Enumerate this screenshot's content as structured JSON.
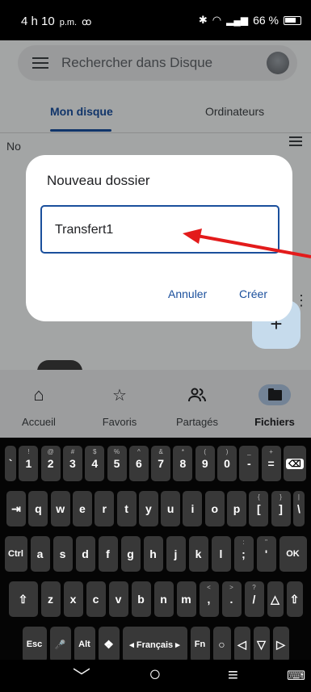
{
  "status": {
    "time": "4 h 10",
    "ampm": "p.m.",
    "voicemail": "ꝏ",
    "battery_pct": "66 %"
  },
  "search": {
    "placeholder": "Rechercher dans Disque"
  },
  "tabs": [
    {
      "label": "Mon disque"
    },
    {
      "label": "Ordinateurs"
    }
  ],
  "behind": {
    "partial_label": "No"
  },
  "dialog": {
    "title": "Nouveau dossier",
    "input_value": "Transfert1",
    "cancel": "Annuler",
    "create": "Créer"
  },
  "fab": {
    "label": "+"
  },
  "bottom_nav": [
    {
      "label": "Accueil",
      "icon": "home-icon",
      "glyph": "⌂"
    },
    {
      "label": "Favoris",
      "icon": "star-icon",
      "glyph": "☆"
    },
    {
      "label": "Partagés",
      "icon": "people-icon",
      "glyph": "👥"
    },
    {
      "label": "Fichiers",
      "icon": "folder-icon",
      "glyph": ""
    }
  ],
  "keyboard": {
    "row1": [
      {
        "k": "`",
        "s": ""
      },
      {
        "k": "1",
        "s": "!"
      },
      {
        "k": "2",
        "s": "@"
      },
      {
        "k": "3",
        "s": "#"
      },
      {
        "k": "4",
        "s": "$"
      },
      {
        "k": "5",
        "s": "%"
      },
      {
        "k": "6",
        "s": "^"
      },
      {
        "k": "7",
        "s": "&"
      },
      {
        "k": "8",
        "s": "*"
      },
      {
        "k": "9",
        "s": "("
      },
      {
        "k": "0",
        "s": ")"
      },
      {
        "k": "-",
        "s": "_"
      },
      {
        "k": "=",
        "s": "+"
      },
      {
        "k": "⌫",
        "s": ""
      }
    ],
    "row2": [
      {
        "k": "⇥",
        "s": ""
      },
      {
        "k": "q",
        "s": ""
      },
      {
        "k": "w",
        "s": ""
      },
      {
        "k": "e",
        "s": ""
      },
      {
        "k": "r",
        "s": ""
      },
      {
        "k": "t",
        "s": ""
      },
      {
        "k": "y",
        "s": ""
      },
      {
        "k": "u",
        "s": ""
      },
      {
        "k": "i",
        "s": ""
      },
      {
        "k": "o",
        "s": ""
      },
      {
        "k": "p",
        "s": ""
      },
      {
        "k": "[",
        "s": "{"
      },
      {
        "k": "]",
        "s": "}"
      },
      {
        "k": "\\",
        "s": "|"
      }
    ],
    "row3": [
      {
        "k": "Ctrl",
        "s": ""
      },
      {
        "k": "a",
        "s": ""
      },
      {
        "k": "s",
        "s": ""
      },
      {
        "k": "d",
        "s": ""
      },
      {
        "k": "f",
        "s": ""
      },
      {
        "k": "g",
        "s": ""
      },
      {
        "k": "h",
        "s": ""
      },
      {
        "k": "j",
        "s": ""
      },
      {
        "k": "k",
        "s": ""
      },
      {
        "k": "l",
        "s": ""
      },
      {
        "k": ";",
        "s": ":"
      },
      {
        "k": "'",
        "s": "\""
      },
      {
        "k": "OK",
        "s": ""
      }
    ],
    "row4": [
      {
        "k": "⇧",
        "s": ""
      },
      {
        "k": "z",
        "s": ""
      },
      {
        "k": "x",
        "s": ""
      },
      {
        "k": "c",
        "s": ""
      },
      {
        "k": "v",
        "s": ""
      },
      {
        "k": "b",
        "s": ""
      },
      {
        "k": "n",
        "s": ""
      },
      {
        "k": "m",
        "s": ""
      },
      {
        "k": ",",
        "s": "<"
      },
      {
        "k": ".",
        "s": ">"
      },
      {
        "k": "/",
        "s": "?"
      },
      {
        "k": "△",
        "s": ""
      },
      {
        "k": "⇧",
        "s": ""
      }
    ],
    "row5": [
      {
        "k": "Esc",
        "s": ""
      },
      {
        "k": "🎤",
        "s": ""
      },
      {
        "k": "Alt",
        "s": ""
      },
      {
        "k": "❖",
        "s": ""
      },
      {
        "k": "◂ Français ▸",
        "s": ""
      },
      {
        "k": "Fn",
        "s": ""
      },
      {
        "k": "○",
        "s": ""
      },
      {
        "k": "◁",
        "s": ""
      },
      {
        "k": "▽",
        "s": ""
      },
      {
        "k": "▷",
        "s": ""
      }
    ]
  },
  "navbar": {
    "back": "﹀",
    "home": "○",
    "recents": "≡",
    "keyboard": "⌨"
  }
}
